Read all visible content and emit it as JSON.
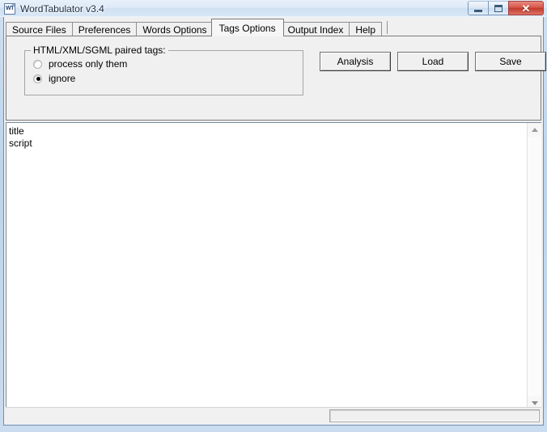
{
  "window": {
    "title": "WordTabulator v3.4",
    "icon_name": "app-document-icon",
    "icon_text": "WT",
    "controls": {
      "minimize": "minimize-icon",
      "maximize": "maximize-icon",
      "close": "✕"
    }
  },
  "tabs": [
    {
      "label": "Source Files",
      "selected": false
    },
    {
      "label": "Preferences",
      "selected": false
    },
    {
      "label": "Words Options",
      "selected": false
    },
    {
      "label": "Tags Options",
      "selected": true
    },
    {
      "label": "Output Index",
      "selected": false
    },
    {
      "label": "Help",
      "selected": false
    }
  ],
  "tags_options": {
    "groupbox_title": "HTML/XML/SGML paired tags:",
    "radio_group": [
      {
        "label": "process only them",
        "checked": false
      },
      {
        "label": "ignore",
        "checked": true
      }
    ],
    "buttons": [
      {
        "label": "Analysis"
      },
      {
        "label": "Load"
      },
      {
        "label": "Save"
      }
    ]
  },
  "editor": {
    "lines": [
      "title",
      "script"
    ],
    "value": "title\nscript"
  },
  "scrollbar": {
    "up_arrow": "scroll-up-icon",
    "down_arrow": "scroll-down-icon"
  },
  "statusbar": {
    "panel_text": ""
  },
  "colors": {
    "titlebar": "#cfe0f2",
    "close_button": "#c13b2d",
    "client_background": "#f0f0f0",
    "editor_background": "#ffffff",
    "frame_border": "#6f8db0"
  }
}
